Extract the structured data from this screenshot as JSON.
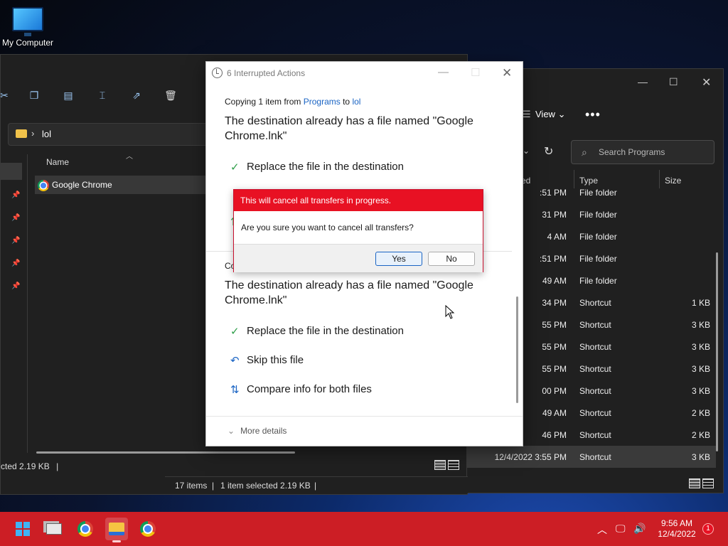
{
  "desktop": {
    "icon_label": "My Computer"
  },
  "left_explorer": {
    "address": "lol",
    "column_name": "Name",
    "file": "Google Chrome",
    "status_left": "cted  2.19 KB",
    "status_items": "17 items",
    "status_selected": "1 item selected  2.19 KB"
  },
  "right_explorer": {
    "view_label": "View",
    "search_placeholder": "Search Programs",
    "columns": {
      "modified": "ed",
      "type": "Type",
      "size": "Size"
    },
    "rows": [
      {
        "date": ":51 PM",
        "type": "File folder",
        "size": ""
      },
      {
        "date": "31 PM",
        "type": "File folder",
        "size": ""
      },
      {
        "date": "4 AM",
        "type": "File folder",
        "size": ""
      },
      {
        "date": ":51 PM",
        "type": "File folder",
        "size": ""
      },
      {
        "date": "49 AM",
        "type": "File folder",
        "size": ""
      },
      {
        "date": "34 PM",
        "type": "Shortcut",
        "size": "1 KB"
      },
      {
        "date": "55 PM",
        "type": "Shortcut",
        "size": "3 KB"
      },
      {
        "date": "55 PM",
        "type": "Shortcut",
        "size": "3 KB"
      },
      {
        "date": "55 PM",
        "type": "Shortcut",
        "size": "3 KB"
      },
      {
        "date": "00 PM",
        "type": "Shortcut",
        "size": "3 KB"
      },
      {
        "date": "49 AM",
        "type": "Shortcut",
        "size": "2 KB"
      },
      {
        "date": "46 PM",
        "type": "Shortcut",
        "size": "2 KB"
      },
      {
        "date": "12/4/2022 3:55 PM",
        "type": "Shortcut",
        "size": "3 KB"
      }
    ]
  },
  "dialog": {
    "title": "6 Interrupted Actions",
    "copy_prefix": "Copying 1 item from",
    "copy_from": "Programs",
    "copy_to_word": "to",
    "copy_to": "lol",
    "message": "The destination already has a file named \"Google Chrome.lnk\"",
    "message2": "The destination already has a file named \"Google Chrome.lnk\"",
    "replace": "Replace the file in the destination",
    "replace2": "Replace the file in the destination",
    "skip": "Skip this file",
    "compare": "Compare info for both files",
    "cut_text": "Co",
    "more_details": "More details"
  },
  "confirm": {
    "header": "This will cancel all transfers in progress.",
    "question": "Are you sure you want to cancel all transfers?",
    "yes": "Yes",
    "no": "No"
  },
  "taskbar": {
    "time": "9:56 AM",
    "date": "12/4/2022",
    "notification_count": "1"
  },
  "colors": {
    "taskbar": "#cc1e25",
    "confirm_header": "#e81123",
    "link": "#1a64c4"
  }
}
